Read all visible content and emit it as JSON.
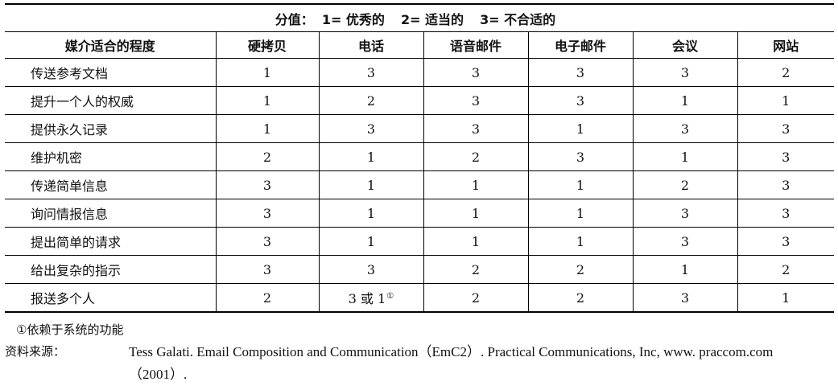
{
  "legend": {
    "prefix": "分值：",
    "items": [
      "1= 优秀的",
      "2= 适当的",
      "3= 不合适的"
    ]
  },
  "columns": [
    "媒介适合的程度",
    "硬拷贝",
    "电话",
    "语音邮件",
    "电子邮件",
    "会议",
    "网站"
  ],
  "rows": [
    {
      "label": "传送参考文档",
      "values": [
        "1",
        "3",
        "3",
        "3",
        "3",
        "2"
      ]
    },
    {
      "label": "提升一个人的权威",
      "values": [
        "1",
        "2",
        "3",
        "3",
        "1",
        "1"
      ]
    },
    {
      "label": "提供永久记录",
      "values": [
        "1",
        "3",
        "3",
        "1",
        "3",
        "3"
      ]
    },
    {
      "label": "维护机密",
      "values": [
        "2",
        "1",
        "2",
        "3",
        "1",
        "3"
      ]
    },
    {
      "label": "传递简单信息",
      "values": [
        "3",
        "1",
        "1",
        "1",
        "2",
        "3"
      ]
    },
    {
      "label": "询问情报信息",
      "values": [
        "3",
        "1",
        "1",
        "1",
        "3",
        "3"
      ]
    },
    {
      "label": "提出简单的请求",
      "values": [
        "3",
        "1",
        "1",
        "1",
        "3",
        "3"
      ]
    },
    {
      "label": "给出复杂的指示",
      "values": [
        "3",
        "3",
        "2",
        "2",
        "1",
        "2"
      ]
    },
    {
      "label": "报送多个人",
      "values": [
        "2",
        "3 或 1",
        "2",
        "2",
        "3",
        "1"
      ]
    }
  ],
  "footnote_marker": "①",
  "footnote": "①依赖于系统的功能",
  "source": {
    "label": "资料来源：",
    "text": "Tess Galati. Email Composition and Communication（EmC2）. Practical Communications, Inc, www. praccom.com（2001）."
  }
}
